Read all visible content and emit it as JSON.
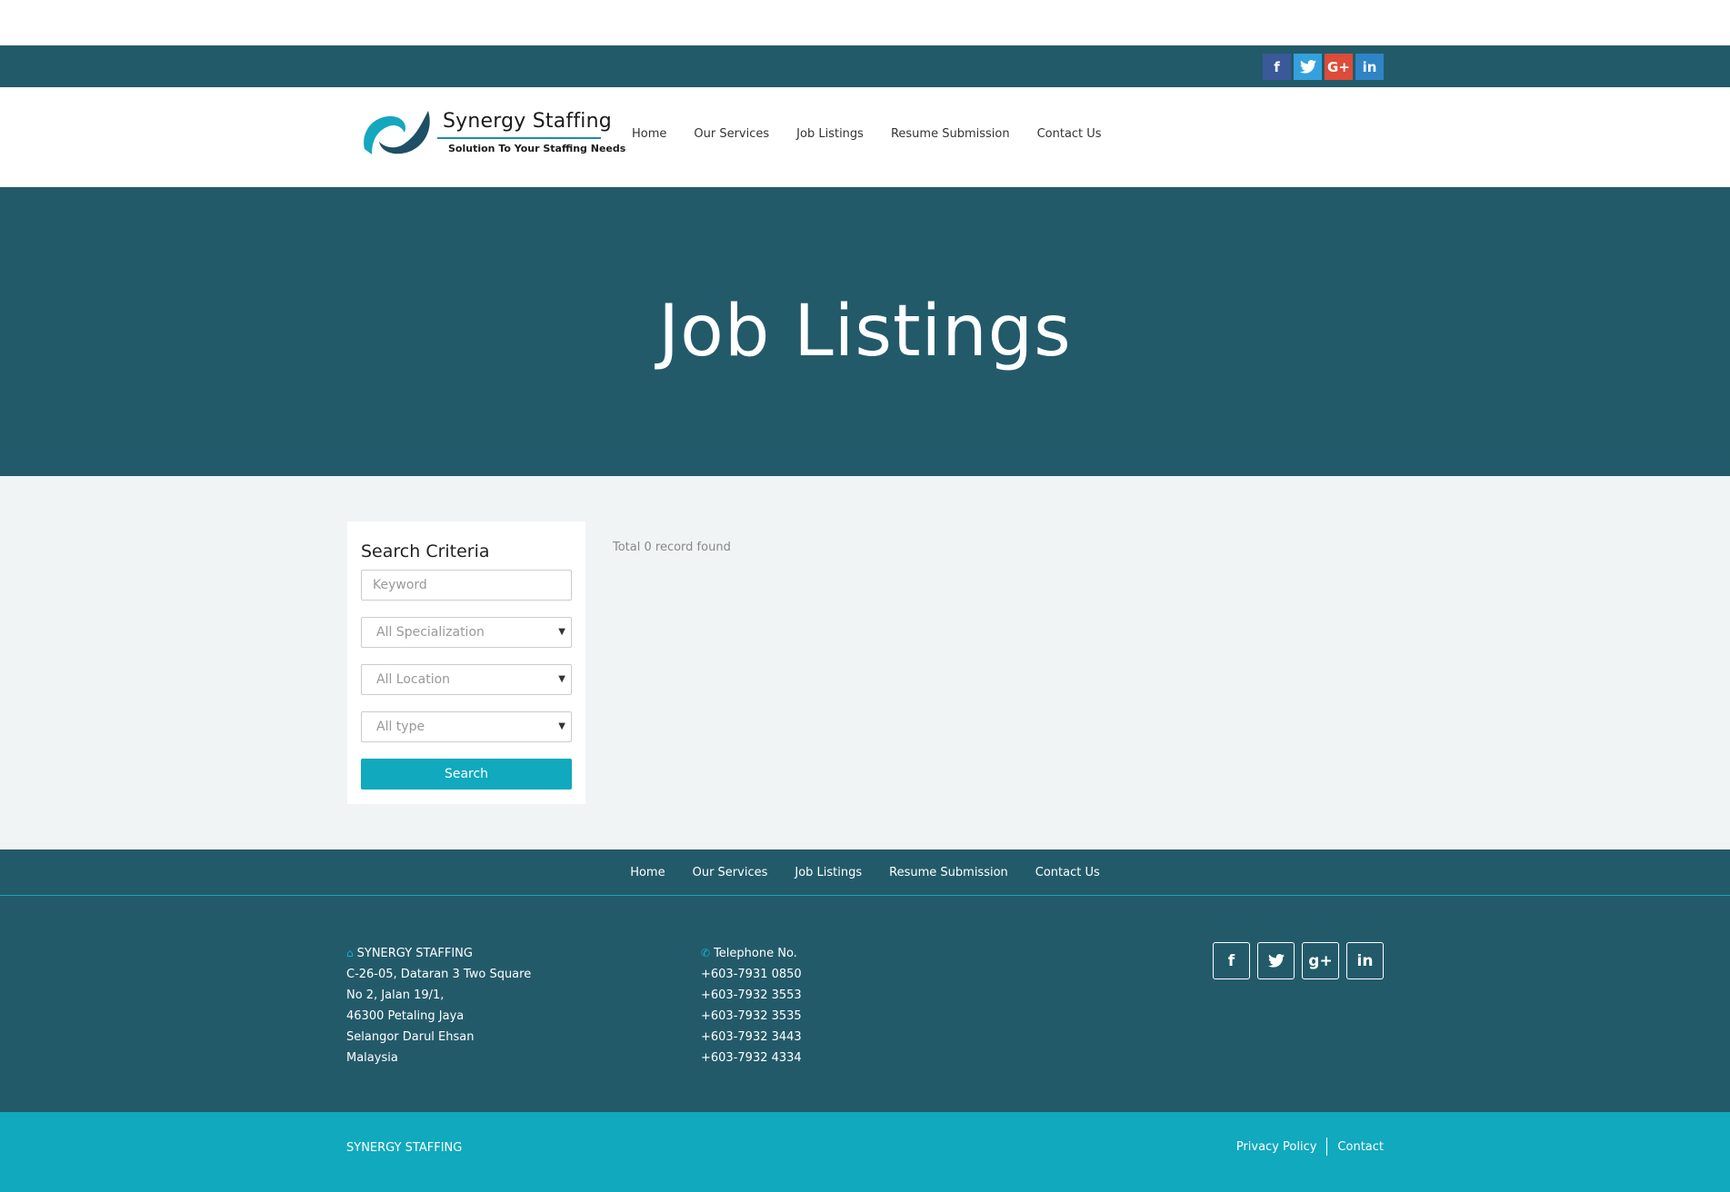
{
  "topbar": {
    "social": [
      {
        "icon": "facebook-icon",
        "glyph": "f"
      },
      {
        "icon": "twitter-icon",
        "glyph": "🐦"
      },
      {
        "icon": "google-plus-icon",
        "glyph": "G+"
      },
      {
        "icon": "linkedin-icon",
        "glyph": "in"
      }
    ]
  },
  "logo": {
    "title": "Synergy Staffing",
    "tagline": "Solution To Your Staffing Needs"
  },
  "nav": {
    "items": [
      "Home",
      "Our Services",
      "Job Listings",
      "Resume Submission",
      "Contact Us"
    ]
  },
  "hero": {
    "title": "Job Listings"
  },
  "search": {
    "heading": "Search Criteria",
    "keyword_placeholder": "Keyword",
    "specialization": "All Specialization",
    "location": "All Location",
    "type": "All type",
    "button": "Search"
  },
  "results": {
    "summary": "Total 0 record found"
  },
  "footer_nav": {
    "items": [
      "Home",
      "Our Services",
      "Job Listings",
      "Resume Submission",
      "Contact Us"
    ]
  },
  "address": {
    "company": "SYNERGY STAFFING",
    "lines": [
      "C-26-05, Dataran 3 Two Square",
      "No 2, Jalan 19/1,",
      "46300 Petaling Jaya",
      "Selangor Darul Ehsan",
      "Malaysia"
    ]
  },
  "telephone": {
    "label": "Telephone No.",
    "numbers": [
      "+603-7931 0850",
      "+603-7932 3553",
      "+603-7932 3535",
      "+603-7932 3443",
      "+603-7932 4334"
    ]
  },
  "footer_social": [
    {
      "icon": "facebook-icon",
      "glyph": "f"
    },
    {
      "icon": "twitter-icon",
      "glyph": "🐦"
    },
    {
      "icon": "google-plus-icon",
      "glyph": "g+"
    },
    {
      "icon": "linkedin-icon",
      "glyph": "in"
    }
  ],
  "bottom": {
    "brand": "SYNERGY STAFFING",
    "privacy": "Privacy Policy",
    "contact": "Contact"
  },
  "colors": {
    "primary_dark": "#235a6a",
    "accent": "#10a9bd",
    "content_bg": "#f0f4f5"
  }
}
